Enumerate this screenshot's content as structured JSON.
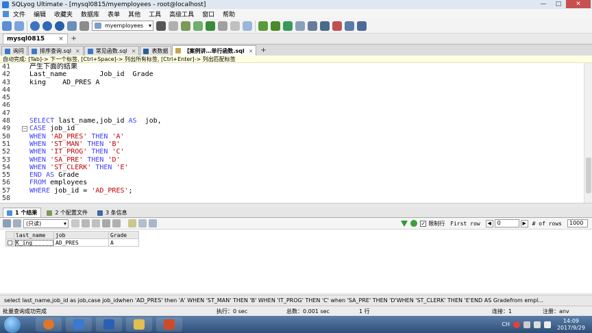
{
  "window": {
    "title": "SQLyog Ultimate - [mysql0815/myemployees - root@localhost]",
    "controls": [
      "—",
      "□",
      "✕"
    ]
  },
  "menu": [
    "文件",
    "编辑",
    "收藏夹",
    "数据库",
    "表单",
    "其他",
    "工具",
    "高级工具",
    "窗口",
    "帮助"
  ],
  "toolbar": {
    "database": "myemployees"
  },
  "connection_tab": {
    "label": "mysql0815",
    "close": "×",
    "add": "+"
  },
  "doc_tabs": [
    {
      "label": "询问",
      "close": "",
      "color": "#3a78c4"
    },
    {
      "label": "排序查询.sql",
      "close": "×",
      "color": "#3a78c4"
    },
    {
      "label": "常见函数.sql",
      "close": "×",
      "color": "#3a78c4"
    },
    {
      "label": "表数据",
      "close": "",
      "color": "#2a5d99"
    },
    {
      "label": "【案例讲…单行函数.sql",
      "close": "×",
      "color": "#c9a24a"
    }
  ],
  "doc_tabs_add": "+",
  "hint": "自动完成: [Tab]-> 下一个标签, [Ctrl+Space]-> 列出所有标签, [Ctrl+Enter]-> 列出匹配标签",
  "editor": {
    "lines": [
      {
        "n": "41",
        "fold": "",
        "parts": [
          [
            "t",
            "产生下面的结果"
          ]
        ]
      },
      {
        "n": "42",
        "fold": "",
        "parts": [
          [
            "t",
            "Last_name        Job_id  Grade"
          ]
        ]
      },
      {
        "n": "43",
        "fold": "",
        "parts": [
          [
            "t",
            "king    AD_PRES A"
          ]
        ]
      },
      {
        "n": "44",
        "fold": "",
        "parts": []
      },
      {
        "n": "45",
        "fold": "",
        "parts": []
      },
      {
        "n": "46",
        "fold": "",
        "parts": []
      },
      {
        "n": "47",
        "fold": "",
        "parts": []
      },
      {
        "n": "48",
        "fold": "",
        "parts": [
          [
            "k",
            "SELECT"
          ],
          [
            "t",
            " last_name,job_id "
          ],
          [
            "k",
            "AS"
          ],
          [
            "t",
            "  job,"
          ]
        ]
      },
      {
        "n": "49",
        "fold": "−",
        "parts": [
          [
            "k",
            "CASE"
          ],
          [
            "t",
            " job_id"
          ]
        ]
      },
      {
        "n": "50",
        "fold": "",
        "parts": [
          [
            "k",
            "WHEN"
          ],
          [
            "t",
            " "
          ],
          [
            "s",
            "'AD_PRES'"
          ],
          [
            "t",
            " "
          ],
          [
            "k",
            "THEN"
          ],
          [
            "t",
            " "
          ],
          [
            "s",
            "'A'"
          ]
        ]
      },
      {
        "n": "51",
        "fold": "",
        "parts": [
          [
            "k",
            "WHEN"
          ],
          [
            "t",
            " "
          ],
          [
            "s",
            "'ST_MAN'"
          ],
          [
            "t",
            " "
          ],
          [
            "k",
            "THEN"
          ],
          [
            "t",
            " "
          ],
          [
            "s",
            "'B'"
          ]
        ]
      },
      {
        "n": "52",
        "fold": "",
        "parts": [
          [
            "k",
            "WHEN"
          ],
          [
            "t",
            " "
          ],
          [
            "s",
            "'IT_PROG'"
          ],
          [
            "t",
            " "
          ],
          [
            "k",
            "THEN"
          ],
          [
            "t",
            " "
          ],
          [
            "s",
            "'C'"
          ]
        ]
      },
      {
        "n": "53",
        "fold": "",
        "parts": [
          [
            "k",
            "WHEN"
          ],
          [
            "t",
            " "
          ],
          [
            "s",
            "'SA_PRE'"
          ],
          [
            "t",
            " "
          ],
          [
            "k",
            "THEN"
          ],
          [
            "t",
            " "
          ],
          [
            "s",
            "'D'"
          ]
        ]
      },
      {
        "n": "54",
        "fold": "",
        "parts": [
          [
            "k",
            "WHEN"
          ],
          [
            "t",
            " "
          ],
          [
            "s",
            "'ST_CLERK'"
          ],
          [
            "t",
            " "
          ],
          [
            "k",
            "THEN"
          ],
          [
            "t",
            " "
          ],
          [
            "s",
            "'E'"
          ]
        ]
      },
      {
        "n": "55",
        "fold": "",
        "parts": [
          [
            "k",
            "END"
          ],
          [
            "t",
            " "
          ],
          [
            "k",
            "AS"
          ],
          [
            "t",
            " Grade"
          ]
        ]
      },
      {
        "n": "56",
        "fold": "",
        "parts": [
          [
            "k",
            "FROM"
          ],
          [
            "t",
            " employees"
          ]
        ]
      },
      {
        "n": "57",
        "fold": "",
        "parts": [
          [
            "k",
            "WHERE"
          ],
          [
            "t",
            " job_id = "
          ],
          [
            "s",
            "'AD_PRES'"
          ],
          [
            "t",
            ";"
          ]
        ]
      },
      {
        "n": "58",
        "fold": "",
        "parts": []
      }
    ]
  },
  "result_tabs": [
    {
      "label": "1 个结果",
      "active": true
    },
    {
      "label": "2 个配置文件",
      "active": false
    },
    {
      "label": "3 条信息",
      "active": false
    }
  ],
  "result_toolbar": {
    "mode": "(只读)",
    "limit_label": "限制行",
    "limit_checked": "✓",
    "first_row_label": "First row",
    "first_row": "0",
    "rows_label": "# of rows",
    "rows": "1000",
    "prev": "◀",
    "next": "▶"
  },
  "grid": {
    "columns": [
      "last_name",
      "job",
      "Grade"
    ],
    "rows": [
      [
        "K_ing",
        "AD_PRES",
        "A"
      ]
    ]
  },
  "sql_status": "select last_name,job_id as  job,case job_idwhen 'AD_PRES' then 'A' WHEN 'ST_MAN' THEN 'B' WHEN 'IT_PROG' THEN 'C' when 'SA_PRE' THEN 'D'WHEN 'ST_CLERK' THEN 'E'END AS Gradefrom empl...",
  "status": {
    "left": "批量查询成功完成",
    "exec": "执行：0 sec",
    "total": "总数：0.001 sec",
    "rows": "1 行",
    "conn": "连接：1",
    "register": "注册：anv"
  },
  "clock": {
    "time": "14:09",
    "date": "2017/9/29"
  },
  "tray_lang": "CH"
}
